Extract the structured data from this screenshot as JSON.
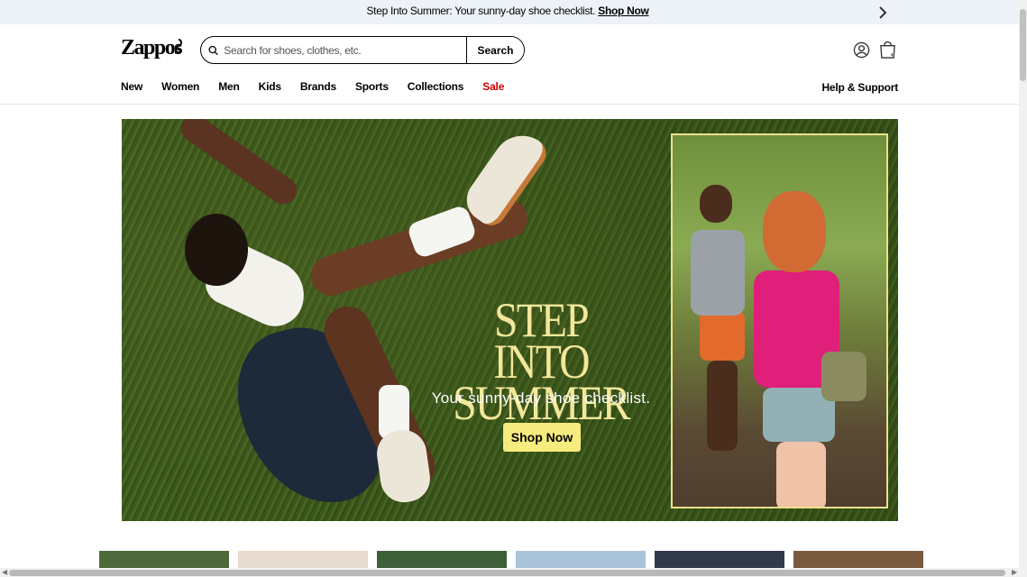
{
  "promo": {
    "text": "Step Into Summer: Your sunny-day shoe checklist.",
    "link": "Shop Now"
  },
  "header": {
    "logo_text": "Zappos"
  },
  "search": {
    "placeholder": "Search for shoes, clothes, etc.",
    "value": "",
    "button": "Search"
  },
  "nav": {
    "items": [
      {
        "label": "New"
      },
      {
        "label": "Women"
      },
      {
        "label": "Men"
      },
      {
        "label": "Kids"
      },
      {
        "label": "Brands"
      },
      {
        "label": "Sports"
      },
      {
        "label": "Collections"
      },
      {
        "label": "Sale"
      }
    ],
    "help": "Help & Support"
  },
  "hero": {
    "headline_line1": "STEP INTO",
    "headline_line2": "SUMMER",
    "subline": "Your sunny-day shoe checklist.",
    "cta": "Shop Now"
  },
  "colors": {
    "sale": "#d10000",
    "accent": "#f6eb7e",
    "headline": "#f2e79a"
  }
}
